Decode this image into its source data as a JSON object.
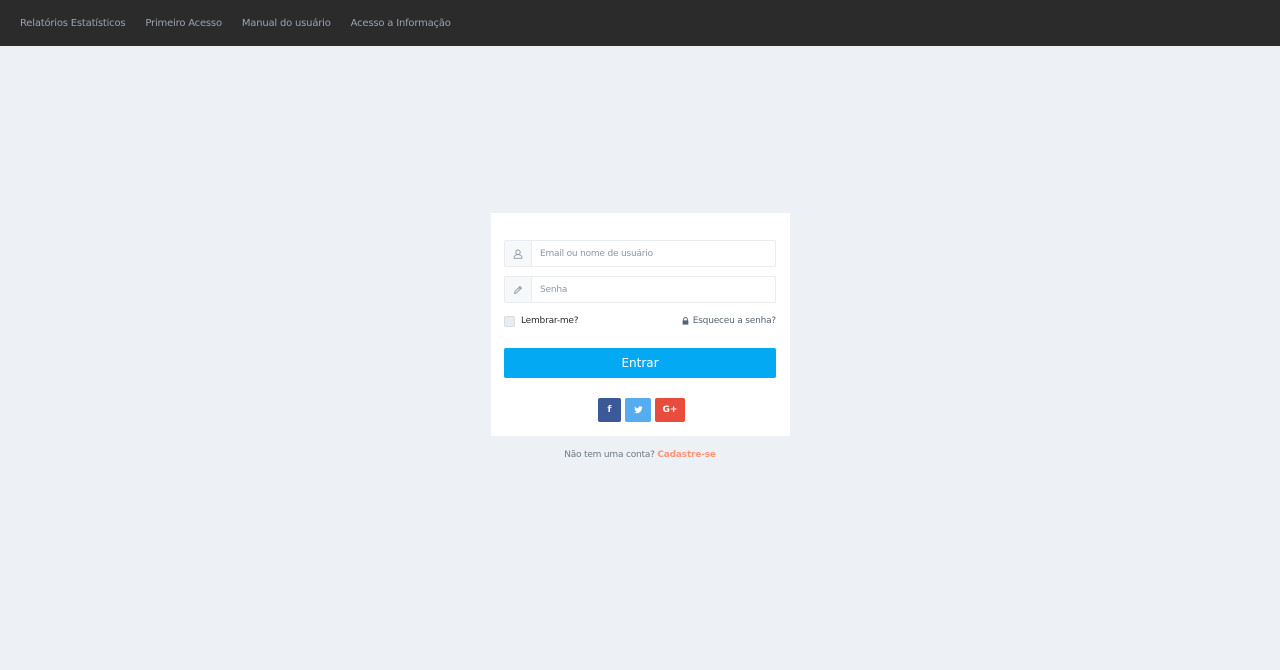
{
  "nav": {
    "items": [
      {
        "label": "Relatórios Estatísticos"
      },
      {
        "label": "Primeiro Acesso"
      },
      {
        "label": "Manual do usuário"
      },
      {
        "label": "Acesso a Informação"
      }
    ]
  },
  "login": {
    "username": {
      "placeholder": "Email ou nome de usuário",
      "value": "",
      "icon": "user-icon"
    },
    "password": {
      "placeholder": "Senha",
      "value": "",
      "icon": "pencil-icon"
    },
    "remember_label": "Lembrar-me?",
    "remember_checked": false,
    "forgot_label": "Esqueceu a senha?",
    "forgot_icon": "lock-icon",
    "submit_label": "Entrar"
  },
  "social": {
    "facebook": "f",
    "twitter": "twitter-icon",
    "google": "G+"
  },
  "signup": {
    "prompt": "Não tem uma conta?",
    "link_label": "Cadastre-se"
  },
  "colors": {
    "topbar": "#2b2b2b",
    "background": "#edf1f5",
    "primary": "#03a9f3",
    "facebook": "#3b5998",
    "twitter": "#55acee",
    "google": "#e74c3c",
    "signup_link": "#fb9678"
  }
}
